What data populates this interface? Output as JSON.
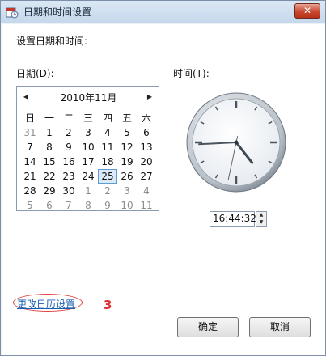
{
  "window": {
    "title": "日期和时间设置",
    "close_label": "✕"
  },
  "heading": "设置日期和时间:",
  "date_label": "日期(D):",
  "time_label": "时间(T):",
  "calendar": {
    "month_title": "2010年11月",
    "prev_icon": "◀",
    "next_icon": "▶",
    "weekdays": [
      "日",
      "一",
      "二",
      "三",
      "四",
      "五",
      "六"
    ],
    "weeks": [
      [
        "31",
        "1",
        "2",
        "3",
        "4",
        "5",
        "6"
      ],
      [
        "7",
        "8",
        "9",
        "10",
        "11",
        "12",
        "13"
      ],
      [
        "14",
        "15",
        "16",
        "17",
        "18",
        "19",
        "20"
      ],
      [
        "21",
        "22",
        "23",
        "24",
        "25",
        "26",
        "27"
      ],
      [
        "28",
        "29",
        "30",
        "1",
        "2",
        "3",
        "4"
      ],
      [
        "5",
        "6",
        "7",
        "8",
        "9",
        "10",
        "11"
      ]
    ],
    "selected_day": "25"
  },
  "clock": {
    "hour": 16,
    "minute": 44,
    "second": 32
  },
  "time_value": "16:44:32",
  "spin": {
    "up_icon": "▲",
    "down_icon": "▼"
  },
  "change_calendar_link": "更改日历设置",
  "annotation": "3",
  "buttons": {
    "ok": "确定",
    "cancel": "取消"
  },
  "colors": {
    "link": "#1a5fb4",
    "annotation": "#e03030",
    "selected": "#dbe9f8"
  }
}
